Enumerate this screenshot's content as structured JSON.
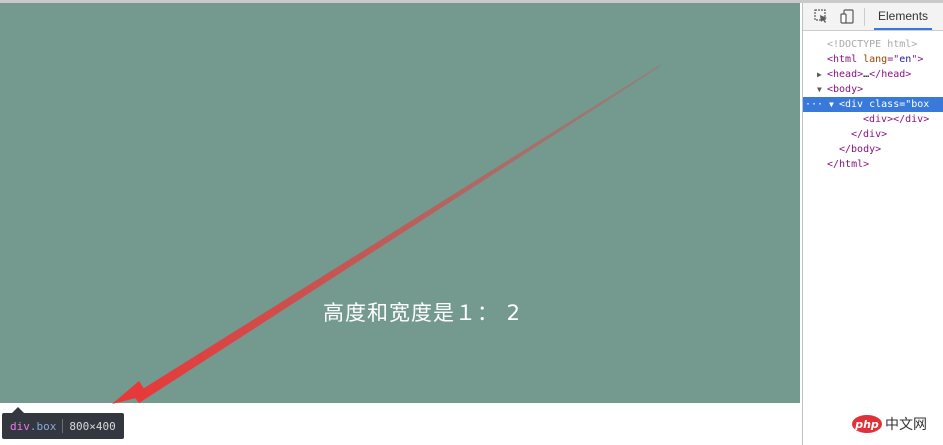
{
  "page": {
    "box_text": "高度和宽度是１： 2"
  },
  "tooltip": {
    "tag": "div",
    "class": ".box",
    "size": "800×400"
  },
  "devtools": {
    "tab_label": "Elements",
    "dom": [
      {
        "indent": 0,
        "parts": [
          {
            "c": "t-doc",
            "t": "<!DOCTYPE html>"
          }
        ]
      },
      {
        "indent": 0,
        "parts": [
          {
            "c": "t-tag",
            "t": "<html "
          },
          {
            "c": "t-attr",
            "t": "lang"
          },
          {
            "c": "t-tag",
            "t": "=\""
          },
          {
            "c": "t-val",
            "t": "en"
          },
          {
            "c": "t-tag",
            "t": "\">"
          }
        ]
      },
      {
        "indent": 0,
        "tri": "▶",
        "parts": [
          {
            "c": "t-tag",
            "t": "<head>"
          },
          {
            "c": "",
            "t": "…"
          },
          {
            "c": "t-tag",
            "t": "</head>"
          }
        ]
      },
      {
        "indent": 0,
        "tri": "▼",
        "parts": [
          {
            "c": "t-tag",
            "t": "<body>"
          }
        ]
      },
      {
        "indent": 1,
        "tri": "▼",
        "selected": true,
        "parts": [
          {
            "c": "t-tag",
            "t": "<div "
          },
          {
            "c": "t-attr",
            "t": "class"
          },
          {
            "c": "t-tag",
            "t": "=\""
          },
          {
            "c": "t-val",
            "t": "box"
          }
        ]
      },
      {
        "indent": 3,
        "parts": [
          {
            "c": "t-tag",
            "t": "<div></div>"
          }
        ]
      },
      {
        "indent": 2,
        "parts": [
          {
            "c": "t-tag",
            "t": "</div>"
          }
        ]
      },
      {
        "indent": 1,
        "parts": [
          {
            "c": "t-tag",
            "t": "</body>"
          }
        ]
      },
      {
        "indent": 0,
        "parts": [
          {
            "c": "t-tag",
            "t": "</html>"
          }
        ]
      }
    ],
    "selected_ellipsis": "···"
  },
  "watermark": {
    "logo": "php",
    "text": "中文网"
  },
  "colors": {
    "box_bg": "#74998f",
    "annotation_arrow": "#e8393a",
    "selection": "#3879d9"
  },
  "icons": [
    "inspect-element-icon",
    "device-toolbar-icon"
  ]
}
